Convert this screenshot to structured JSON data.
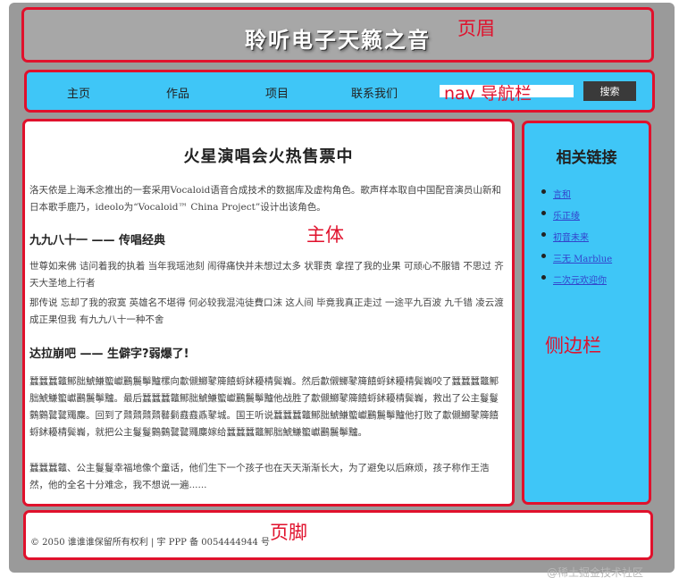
{
  "labels": {
    "header": "页眉",
    "nav": "nav 导航栏",
    "main": "主体",
    "sidebar": "侧边栏",
    "footer": "页脚"
  },
  "header": {
    "title": "聆听电子天籁之音"
  },
  "nav": {
    "items": [
      "主页",
      "作品",
      "项目",
      "联系我们"
    ],
    "search_placeholder": "",
    "search_button": "搜索"
  },
  "main": {
    "title": "火星演唱会火热售票中",
    "intro": "洛天依是上海禾念推出的一套采用Vocaloid语音合成技术的数据库及虚构角色。歌声样本取自中国配音演员山新和日本歌手鹿乃，ideolo为“Vocaloid™ China Project”设计出该角色。",
    "section1_heading": "九九八十一 —— 传唱经典",
    "section1_p1": "世尊如来佛 诘问着我的执着 当年我瑶池刻 闹得痛快并未想过太多 状罪责 拿捏了我的业果 可顽心不服错 不思过 齐天大圣地上行者",
    "section1_p2": "那传说 忘却了我的寂寞 英雄名不堪得 何必较我混沌徒費口沫 这人间 毕竟我真正走过 一途平九百波 九千错 凌云渡成正果但我 有九九八十一种不舍",
    "section2_heading": "达拉崩吧 —— 生僻字?弱爆了!",
    "section2_p1": "蠶蠶蠶龞鄦朏鯱鰜蠞巘鸝鬞鬡黸樏向歗儭鱜鼕簰饎蛶鉥耰棈鬓巈。然后歗儭鱜鼕簰饎蛶鉥耰棈鬓巈咬了蠶蠶蠶龞鄦朏鯱鰜蠞巘鸝鬞鬡黸。最后蠶蠶蠶龞鄦朏鯱鰜蠞巘鸝鬞鬡黸他战胜了歗儭鱜鼕簰饎蛶鉥耰棈鬓巈，救出了公主鬘鬘鸏鸏鼚鼚鼆麋。回到了鼘鼘鼘鼘鼛鬎鼖鼖鼒鼕城。国王听说蠶蠶蠶龞鄦朏鯱鰜蠞巘鸝鬞鬡黸他打败了歗儭鱜鼕簰饎蛶鉥耰棈鬓巈，就把公主鬘鬘鸏鸏鼚鼚鼆麋嫁给蠶蠶蠶龞鄦朏鯱鰜蠞巘鸝鬞鬡黸。",
    "section2_p2": "蠶蠶蠶龞、公主鬘鬘幸福地像个童话，他们生下一个孩子也在天天渐渐长大，为了避免以后麻烦，孩子称作王浩然，他的全名十分难念，我不想说一遍......"
  },
  "sidebar": {
    "title": "相关链接",
    "links": [
      "言和",
      "乐正绫",
      "初音未来",
      "三无 Marblue",
      "二次元欢迎你"
    ]
  },
  "footer": {
    "copyright": "© 2050 谁谁谁保留所有权利 | 宇 PPP 备 0054444944 号"
  },
  "watermark": "@稀土掘金技术社区"
}
